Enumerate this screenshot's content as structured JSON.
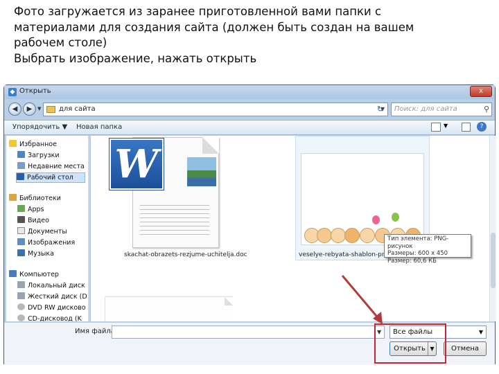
{
  "slide": {
    "line1": "Фото загружается из заранее приготовленной вами папки с",
    "line2": "материалами для создания сайта (должен быть создан на вашем",
    "line3": "рабочем столе)",
    "line4": "Выбрать изображение, нажать открыть"
  },
  "dialog": {
    "title": "Открыть",
    "close": "x",
    "address": "для сайта",
    "search_placeholder": "Поиск: для сайта"
  },
  "toolbar": {
    "organize": "Упорядочить ▼",
    "new_folder": "Новая папка"
  },
  "sidebar": {
    "favorites": "Избранное",
    "downloads": "Загрузки",
    "recent": "Недавние места",
    "desktop": "Рабочий стол",
    "libraries": "Библиотеки",
    "apps": "Apps",
    "video": "Видео",
    "documents": "Документы",
    "images": "Изображения",
    "music": "Музыка",
    "computer": "Компьютер",
    "local_disk": "Локальный диск",
    "hard_disk": "Жесткий диск (D",
    "dvd": "DVD RW дисково",
    "cd": "CD-дисковод (K"
  },
  "files": {
    "file1_name": "skachat-obrazets-rezjume-uchitelja.doc",
    "file2_name": "veselye-rebyata-shablon-prevew"
  },
  "tooltip": {
    "type": "Тип элемента: PNG-рисунок",
    "size": "Размеры: 600 x 450",
    "filesize": "Размер: 60,6 КБ"
  },
  "bottom": {
    "filename_label": "Имя файла:",
    "filename_value": "",
    "filter_value": "Все файлы",
    "open_button": "Открыть",
    "cancel_button": "Отмена"
  },
  "colors": {
    "highlight": "#c8242c",
    "arrow": "#b33a3a",
    "word_blue": "#2a63b2"
  }
}
